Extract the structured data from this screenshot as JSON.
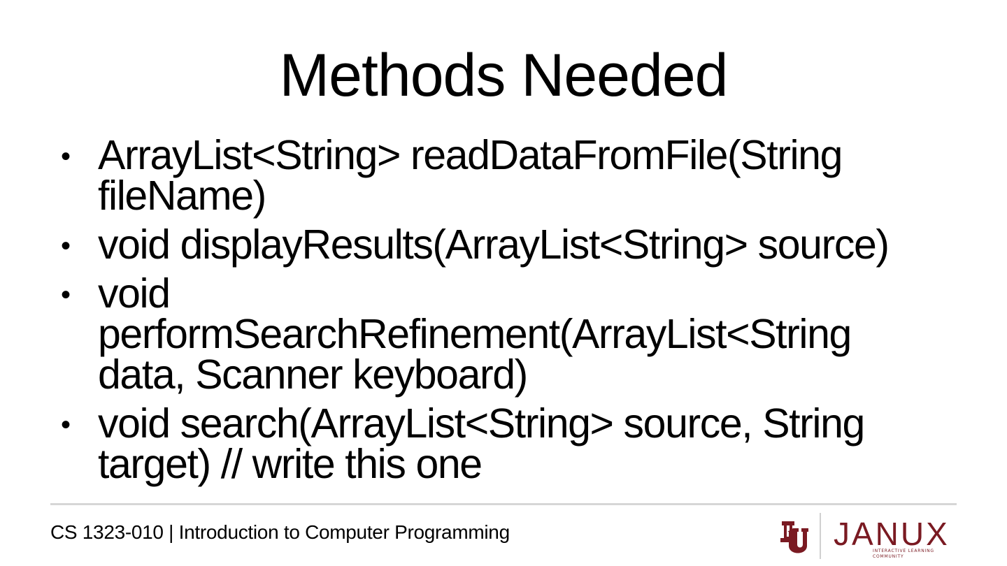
{
  "slide": {
    "title": "Methods Needed",
    "bullets": [
      {
        "text": "ArrayList<String> readDataFromFile(String\nfileName)"
      },
      {
        "text": "void displayResults(ArrayList<String> source)"
      },
      {
        "text": "void\nperformSearchRefinement(ArrayList<String\ndata, Scanner keyboard)"
      },
      {
        "text": "void search(ArrayList<String> source, String\ntarget) // write this one"
      }
    ],
    "bullet_symbol": "•"
  },
  "footer": {
    "course": "CS 1323-010 | Introduction to Computer Programming",
    "logo_word": "JANUX",
    "logo_tagline": "INTERACTIVE LEARNING COMMUNITY",
    "logo_color": "#7a1a22",
    "ou_icon": "ou-logo-icon"
  }
}
